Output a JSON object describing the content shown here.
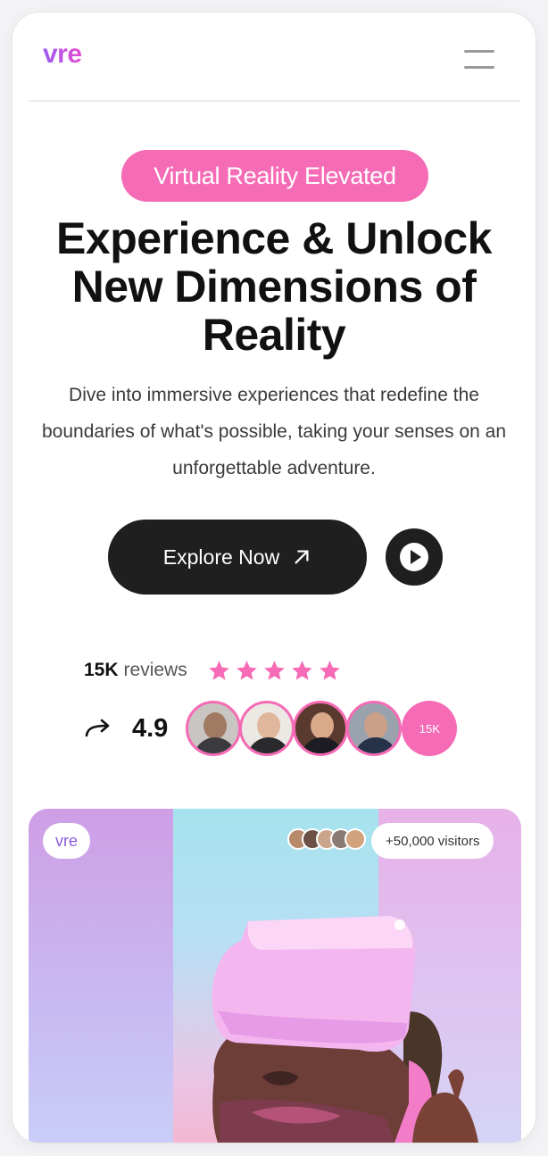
{
  "header": {
    "logo": "vre",
    "menu_icon": "hamburger-menu-icon"
  },
  "hero": {
    "badge": "Virtual Reality Elevated",
    "title": "Experience & Unlock New Dimensions of Reality",
    "description": "Dive into immersive experiences that redefine the boundaries of what's possible, taking your senses on an unforgettable adventure.",
    "explore_label": "Explore Now",
    "play_icon": "play-icon"
  },
  "reviews": {
    "count": "15K",
    "word": "reviews",
    "stars": 5,
    "rating": "4.9",
    "avatar_count_label": "15K"
  },
  "visual": {
    "logo_chip": "vre",
    "visitors": "+50,000 visitors"
  },
  "colors": {
    "accent_pink": "#f56bb5",
    "dark_button": "#1f1f1f",
    "logo_gradient_start": "#9b5cf0",
    "logo_gradient_end": "#e64ad0"
  }
}
